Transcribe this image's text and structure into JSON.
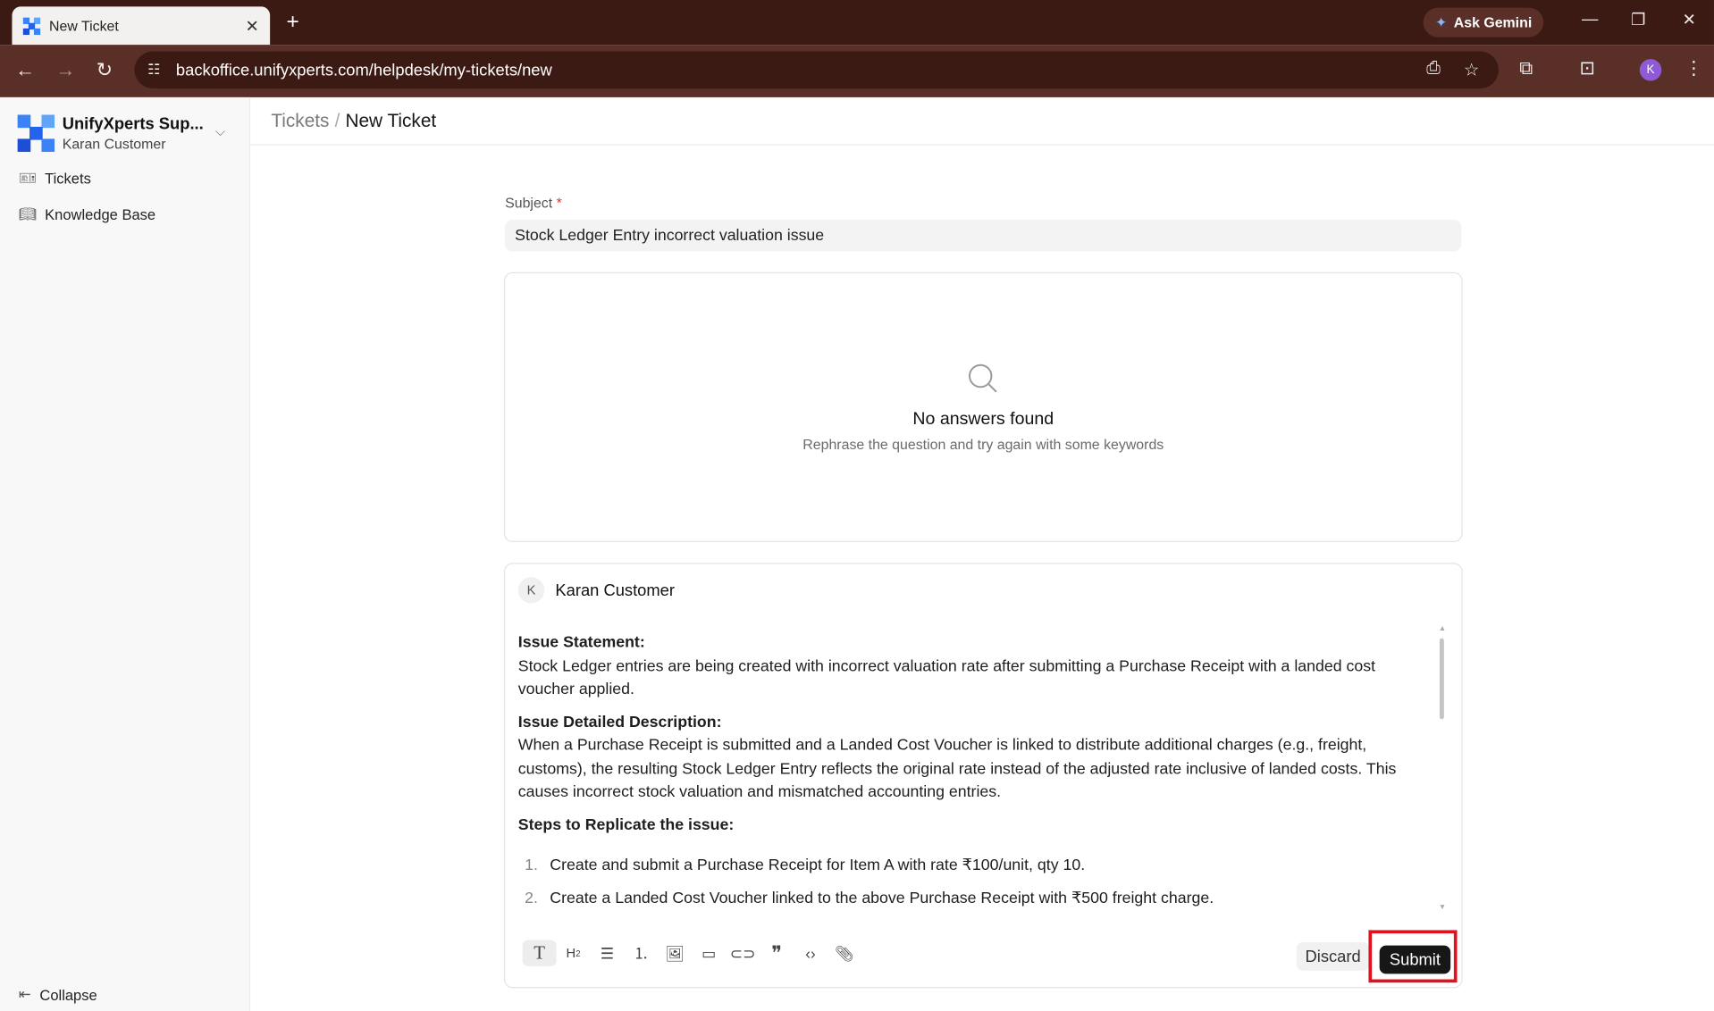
{
  "browser": {
    "tab_title": "New Ticket",
    "tab_close": "✕",
    "new_tab": "+",
    "gemini_label": "Ask Gemini",
    "url": "backoffice.unifyxperts.com/helpdesk/my-tickets/new",
    "profile_initial": "K"
  },
  "sidebar": {
    "brand_name": "UnifyXperts Sup...",
    "brand_user": "Karan Customer",
    "items": [
      {
        "label": "Tickets",
        "icon": "ticket-icon"
      },
      {
        "label": "Knowledge Base",
        "icon": "book-icon"
      }
    ],
    "collapse_label": "Collapse"
  },
  "header": {
    "crumb_parent": "Tickets",
    "crumb_sep": "/",
    "crumb_current": "New Ticket"
  },
  "form": {
    "subject_label": "Subject",
    "subject_required": "*",
    "subject_value": "Stock Ledger Entry incorrect valuation issue",
    "answers_title": "No answers found",
    "answers_hint": "Rephrase the question and try again with some keywords"
  },
  "editor": {
    "author_initial": "K",
    "author_name": "Karan Customer",
    "issue_statement_heading": "Issue Statement:",
    "issue_statement_text": "Stock Ledger entries are being created with incorrect valuation rate after submitting a Purchase Receipt with a landed cost voucher applied.",
    "description_heading": "Issue Detailed Description:",
    "description_text": "When a Purchase Receipt is submitted and a Landed Cost Voucher is linked to distribute additional charges (e.g., freight, customs), the resulting Stock Ledger Entry reflects the original rate instead of the adjusted rate inclusive of landed costs. This causes incorrect stock valuation and mismatched accounting entries.",
    "steps_heading": "Steps to Replicate the issue:",
    "steps": [
      {
        "num": "1.",
        "text": "Create and submit a Purchase Receipt for Item A with rate ₹100/unit, qty 10."
      },
      {
        "num": "2.",
        "text": "Create a Landed Cost Voucher linked to the above Purchase Receipt with ₹500 freight charge."
      }
    ],
    "discard_label": "Discard",
    "submit_label": "Submit"
  },
  "colors": {
    "tab_bar": "#3b1a14",
    "toolbar": "#5a2f27",
    "highlight": "#e0121d",
    "submit_bg": "#171717"
  }
}
